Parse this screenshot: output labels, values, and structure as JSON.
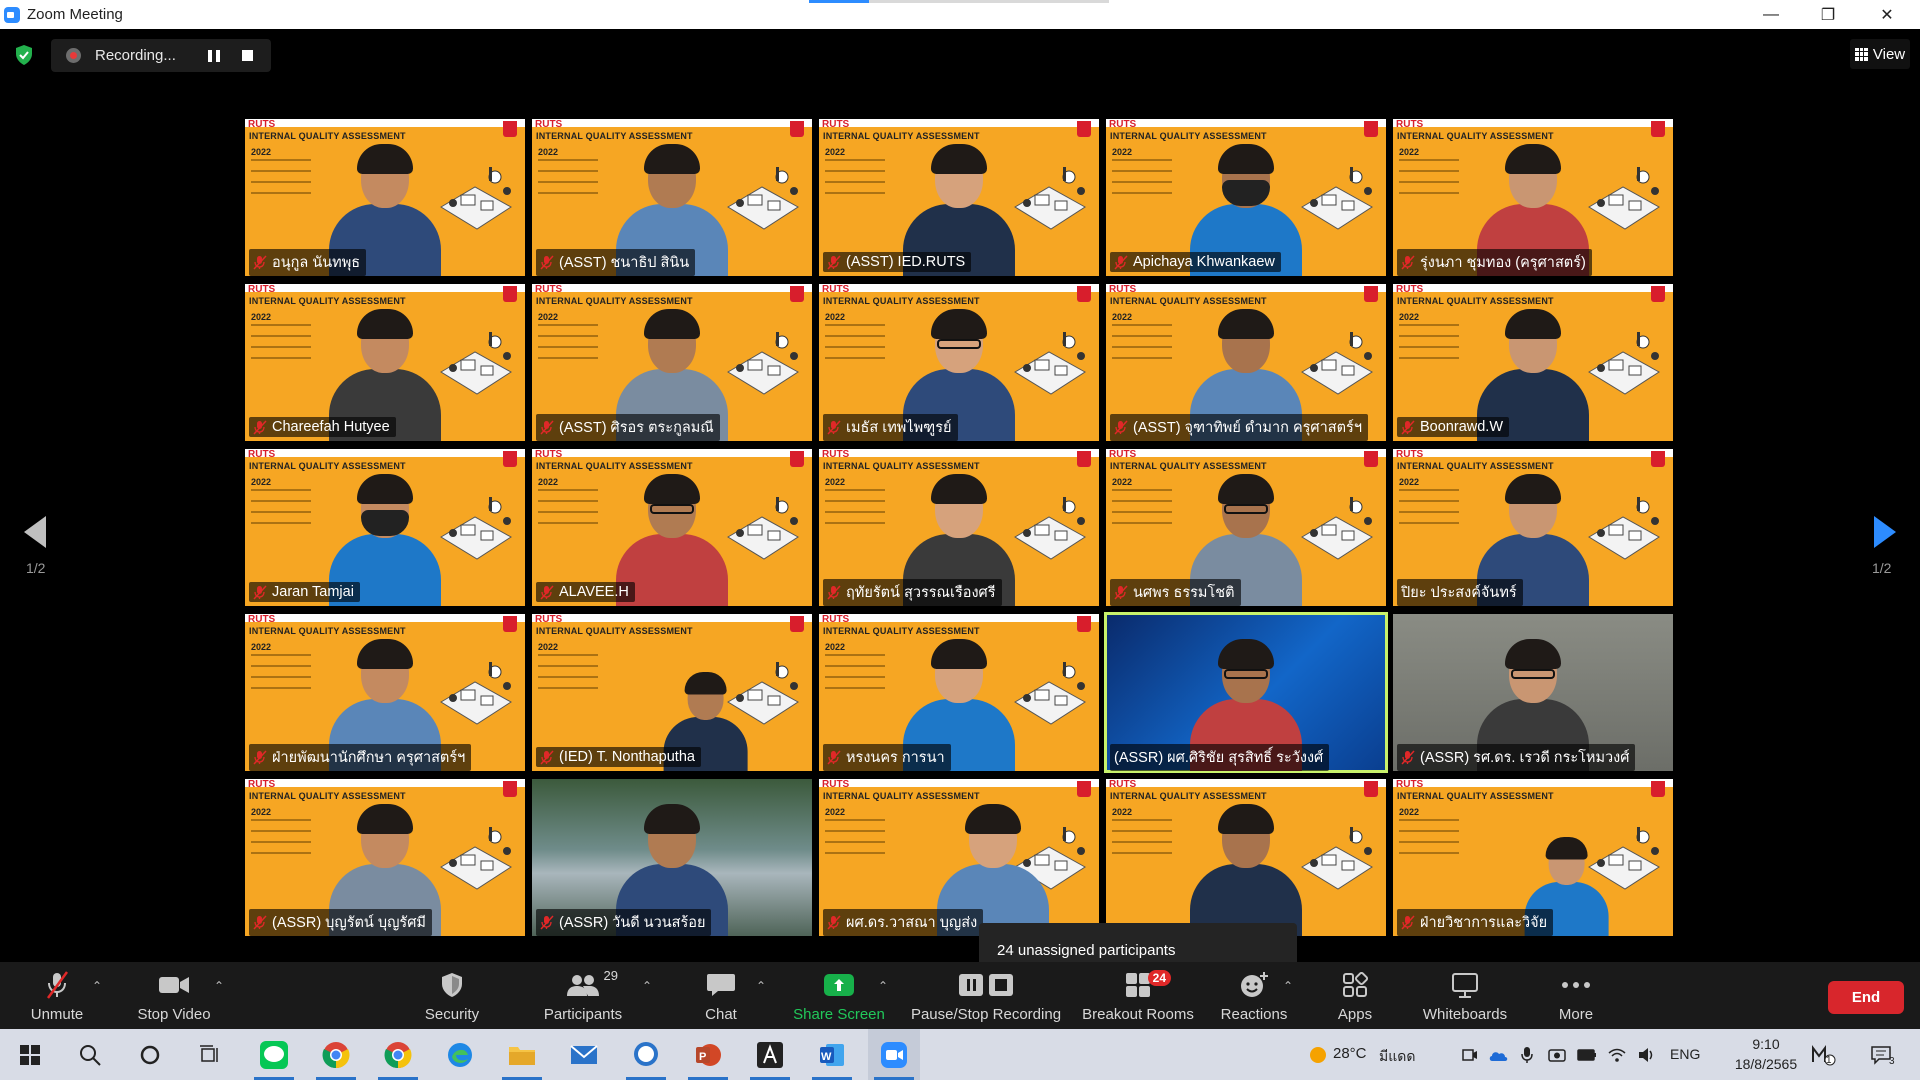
{
  "window": {
    "title": "Zoom Meeting",
    "minimize_glyph": "—",
    "restore_glyph": "❐",
    "close_glyph": "✕",
    "load_progress": 0.2
  },
  "recording": {
    "label": "Recording...",
    "icon": "recording-dot-icon"
  },
  "view": {
    "label": "View"
  },
  "paging": {
    "left_label": "1/2",
    "right_label": "1/2",
    "right_arrow_color": "#2d8cff",
    "left_arrow_color": "#bfbfbf"
  },
  "slide": {
    "title": "INTERNAL QUALITY ASSESSMENT",
    "logo": "RUTS",
    "year": "2022"
  },
  "participants": [
    {
      "name": "อนุกูล นันทพุธ",
      "bg": "slide",
      "muted": true
    },
    {
      "name": "(ASST) ชนาธิป สินิน",
      "bg": "slide",
      "muted": true
    },
    {
      "name": "(ASST) IED.RUTS",
      "bg": "slide",
      "muted": true
    },
    {
      "name": "Apichaya Khwankaew",
      "bg": "slide",
      "muted": true
    },
    {
      "name": "รุ่งนภา ชุมทอง (ครุศาสตร์)",
      "bg": "slide",
      "muted": true
    },
    {
      "name": "Chareefah Hutyee",
      "bg": "slide",
      "muted": true
    },
    {
      "name": "(ASST) ศิรอร ตระกูลมณี",
      "bg": "slide",
      "muted": true
    },
    {
      "name": "เมธัส เทพไพฑูรย์",
      "bg": "slide",
      "muted": true
    },
    {
      "name": "(ASST) จุฑาทิพย์ ดำมาก ครุศาสตร์ฯ",
      "bg": "slide",
      "muted": true
    },
    {
      "name": "Boonrawd.W",
      "bg": "slide",
      "muted": true
    },
    {
      "name": "Jaran Tamjai",
      "bg": "slide",
      "muted": true
    },
    {
      "name": "ALAVEE.H",
      "bg": "slide",
      "muted": true
    },
    {
      "name": "ฤทัยรัตน์ สุวรรณเรืองศรี",
      "bg": "slide",
      "muted": true
    },
    {
      "name": "นศพร ธรรมโชติ",
      "bg": "slide",
      "muted": true
    },
    {
      "name": "ปิยะ ประสงค์จันทร์",
      "bg": "slide",
      "muted": false
    },
    {
      "name": "ฝ่ายพัฒนานักศึกษา ครุศาสตร์ฯ",
      "bg": "slide",
      "muted": true
    },
    {
      "name": "(IED) T. Nonthaputha",
      "bg": "slide",
      "muted": true
    },
    {
      "name": "หรงนคร การนา",
      "bg": "slide",
      "muted": true
    },
    {
      "name": "(ASSR) ผศ.ศิริชัย สุรสิทธิ์ ระวังงศ์",
      "bg": "blue",
      "muted": false,
      "active": true
    },
    {
      "name": "(ASSR) รศ.ดร. เรวดี กระโหมวงศ์",
      "bg": "room",
      "muted": true
    },
    {
      "name": "(ASSR) บุญรัตน์ บุญรัศมี",
      "bg": "slide",
      "muted": true
    },
    {
      "name": "(ASSR) วันดี นวนสร้อย",
      "bg": "lake",
      "muted": true
    },
    {
      "name": "ผศ.ดร.วาสณา บุญส่ง",
      "bg": "slide",
      "muted": true
    },
    {
      "name": "",
      "bg": "slide",
      "muted": false
    },
    {
      "name": "ฝ่ายวิชาการและวิจัย",
      "bg": "slide",
      "muted": true
    }
  ],
  "tooltip": {
    "text": "24 unassigned participants"
  },
  "toolbar": {
    "unmute": "Unmute",
    "stop_video": "Stop Video",
    "security": "Security",
    "participants": "Participants",
    "participants_count": "29",
    "chat": "Chat",
    "share_screen": "Share Screen",
    "pause_stop_recording": "Pause/Stop Recording",
    "breakout_rooms": "Breakout Rooms",
    "breakout_count": "24",
    "reactions": "Reactions",
    "apps": "Apps",
    "whiteboards": "Whiteboards",
    "more": "More",
    "end": "End",
    "caret": "⌃"
  },
  "taskbar": {
    "weather_temp": "28°C",
    "weather_text": "มีแดด",
    "lang": "ENG",
    "time": "9:10",
    "date": "18/8/2565",
    "notifications": "3",
    "tray_badge": "1"
  },
  "colors": {
    "accent": "#2d8cff",
    "share_green": "#17b04a",
    "end_red": "#d8262c",
    "slide_orange": "#f6a623",
    "active_speaker": "#c9f26b",
    "mute_red": "#e02828"
  }
}
